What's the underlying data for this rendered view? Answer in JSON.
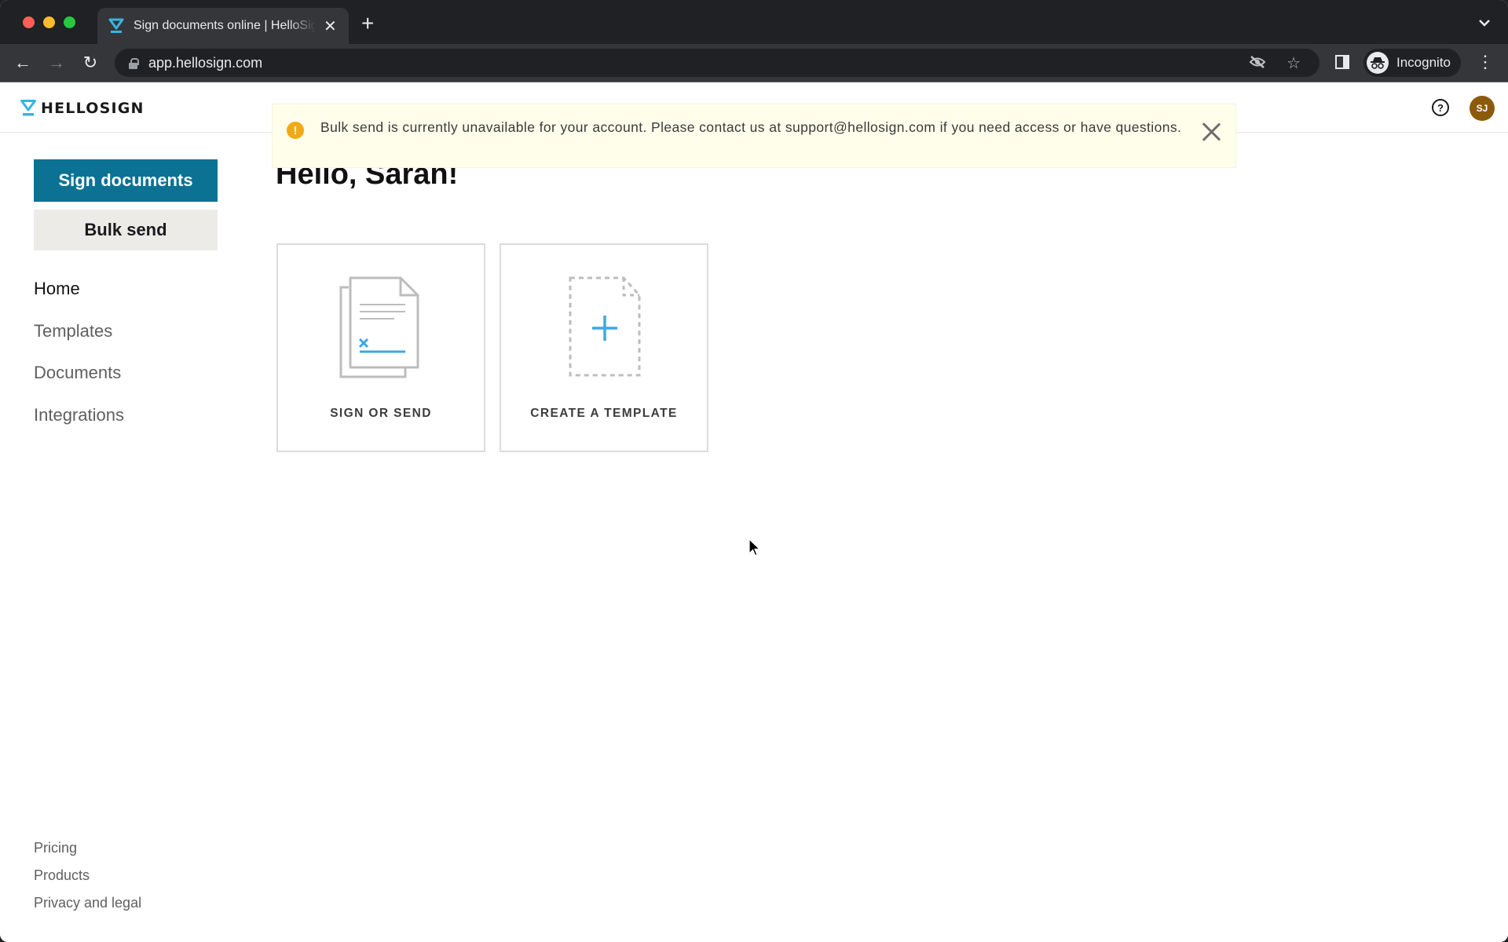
{
  "browser": {
    "tab": {
      "title": "Sign documents online | HelloSign",
      "favicon": "hellosign-logo-icon"
    },
    "new_tab_label": "+",
    "url": "app.hellosign.com",
    "profile_label": "Incognito",
    "icons": {
      "back": "←",
      "forward": "→",
      "reload": "↻",
      "tracking": "eye-slash-icon",
      "bookmark": "☆",
      "menu": "⋮",
      "tab_list": "⌄",
      "tab_close": "✕"
    }
  },
  "app": {
    "logo_text": "HELLOSIGN",
    "brand_colors": {
      "primary": "#0b7294",
      "logo_accent": "#35b6e0",
      "avatar": "#8b5a0b",
      "warning": "#f2a918",
      "banner_bg": "#fffeeb"
    },
    "header": {
      "help_icon": "?",
      "user_initials": "SJ"
    },
    "banner": {
      "icon": "!",
      "message": "Bulk send is currently unavailable for your account. Please contact us at support@hellosign.com if you need access or have questions."
    },
    "sidebar": {
      "primary_button": "Sign documents",
      "secondary_button": "Bulk send",
      "nav": [
        {
          "label": "Home",
          "active": true
        },
        {
          "label": "Templates",
          "active": false
        },
        {
          "label": "Documents",
          "active": false
        },
        {
          "label": "Integrations",
          "active": false
        }
      ],
      "footer": [
        {
          "label": "Pricing"
        },
        {
          "label": "Products"
        },
        {
          "label": "Privacy and legal"
        }
      ]
    },
    "main": {
      "greeting": "Hello, Sarah!",
      "cards": [
        {
          "label": "SIGN OR SEND",
          "icon": "document-sign-icon"
        },
        {
          "label": "CREATE A TEMPLATE",
          "icon": "new-template-icon"
        }
      ]
    }
  }
}
